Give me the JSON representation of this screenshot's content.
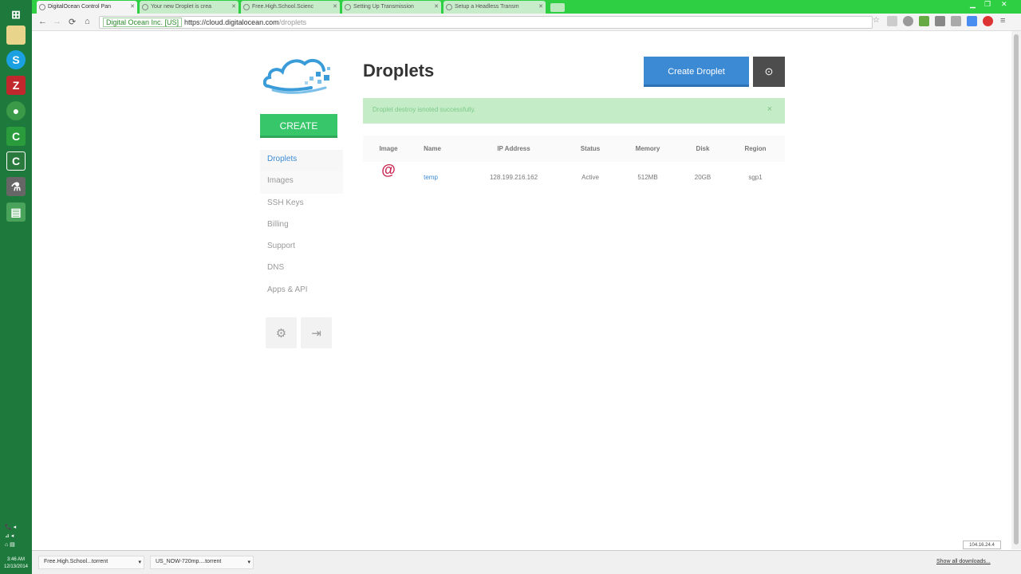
{
  "taskbar": {
    "icons": [
      "explorer-icon",
      "skype-icon",
      "filezilla-icon",
      "chrome-icon",
      "camtasia-icon",
      "camtasia-recorder-icon",
      "app-icon",
      "app2-icon"
    ],
    "time": "3:46 AM",
    "date": "12/13/2014"
  },
  "browser": {
    "tabs": [
      {
        "label": "DigitalOcean Control Pan"
      },
      {
        "label": "Your new Droplet is crea"
      },
      {
        "label": "Free.High.School.Scienc"
      },
      {
        "label": "Setting Up Transmission"
      },
      {
        "label": "Setup a Headless Transm"
      }
    ],
    "nav": {
      "back": "←",
      "forward": "→",
      "reload": "⟳",
      "home": "⌂"
    },
    "ev_label": "Digital Ocean Inc. [US]",
    "url_host": "https://cloud.digitalocean.com",
    "url_path": "/droplets"
  },
  "sidebar": {
    "create_label": "CREATE",
    "items": [
      {
        "label": "Droplets"
      },
      {
        "label": "Images"
      },
      {
        "label": "SSH Keys"
      },
      {
        "label": "Billing"
      },
      {
        "label": "Support"
      },
      {
        "label": "DNS"
      },
      {
        "label": "Apps & API"
      }
    ]
  },
  "main": {
    "title": "Droplets",
    "create_droplet_label": "Create Droplet",
    "alert": "Droplet destroy isnoted successfully.",
    "table": {
      "headers": [
        "Image",
        "Name",
        "IP Address",
        "Status",
        "Memory",
        "Disk",
        "Region"
      ],
      "rows": [
        {
          "image_icon": "debian-icon",
          "name": "temp",
          "ip": "128.199.216.162",
          "status": "Active",
          "memory": "512MB",
          "disk": "20GB",
          "region": "sgp1"
        }
      ]
    }
  },
  "downloads": {
    "items": [
      {
        "label": "Free.High.School...torrent"
      },
      {
        "label": "US_NOW-720mp....torrent"
      }
    ],
    "show_all": "Show all downloads..."
  },
  "status_ip": "104.16.24.4",
  "colors": {
    "accent_blue": "#3c8ad4",
    "create_green": "#38c66b",
    "tab_green": "#2fcf44",
    "debian_red": "#c8244e"
  }
}
